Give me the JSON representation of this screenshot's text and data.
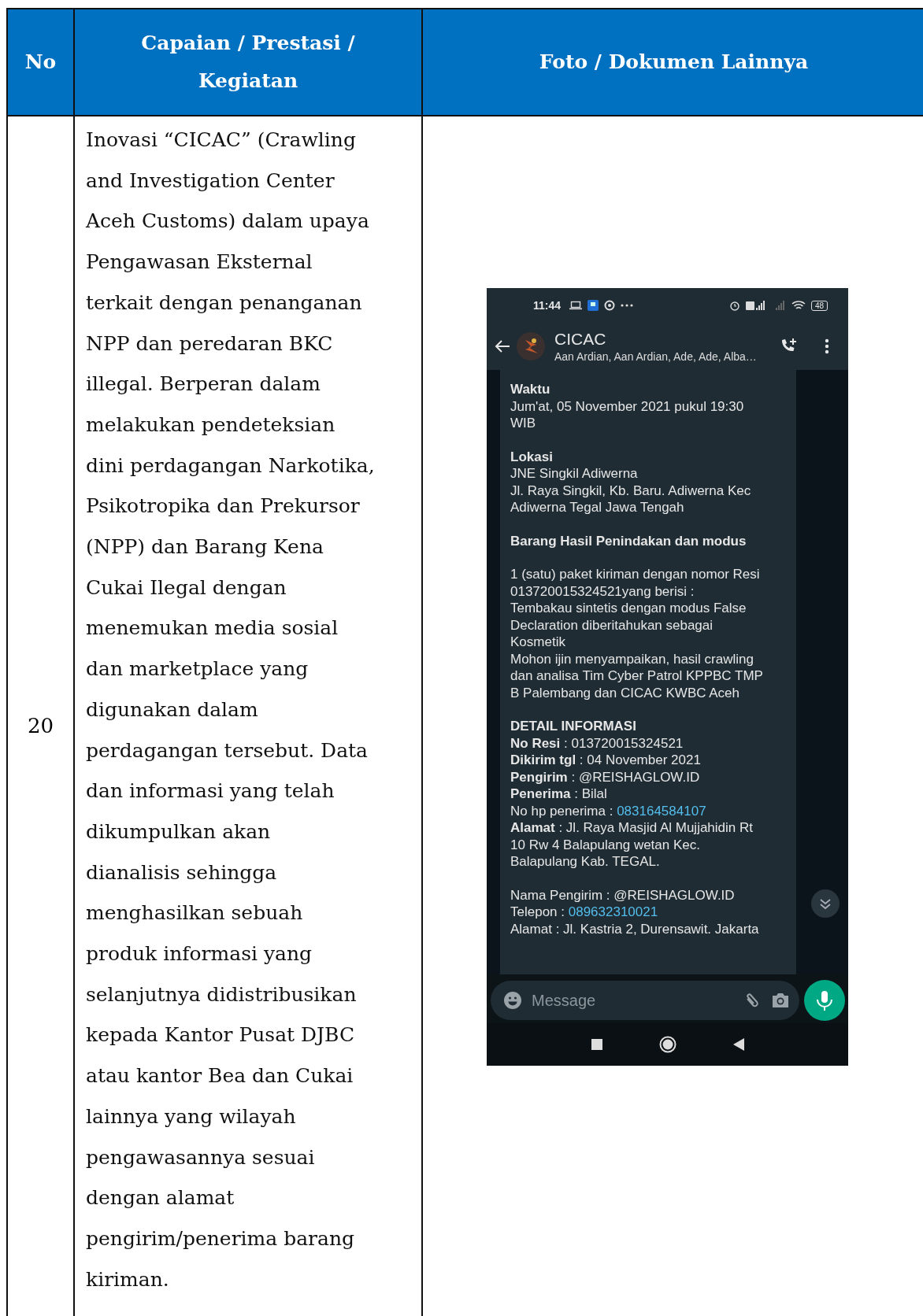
{
  "table": {
    "columns": [
      "No",
      "Capaian / Prestasi / Kegiatan",
      "Foto / Dokumen Lainnya"
    ],
    "rows": [
      {
        "no": "20",
        "description_lines": [
          "Inovasi “CICAC” (Crawling",
          "and Investigation Center",
          "Aceh Customs) dalam upaya",
          "Pengawasan Eksternal",
          "terkait dengan penanganan",
          "NPP dan peredaran BKC",
          "illegal. Berperan dalam",
          "melakukan pendeteksian",
          "dini perdagangan Narkotika,",
          "Psikotropika dan Prekursor",
          "(NPP) dan Barang Kena",
          "Cukai Ilegal dengan",
          "menemukan media sosial",
          "dan marketplace yang",
          "digunakan dalam",
          "perdagangan tersebut. Data",
          "dan informasi yang telah",
          "dikumpulkan akan",
          "dianalisis sehingga",
          "menghasilkan sebuah",
          "produk informasi yang",
          "selanjutnya didistribusikan",
          "kepada Kantor Pusat DJBC",
          "atau kantor Bea dan Cukai",
          "lainnya yang wilayah",
          "pengawasannya sesuai",
          "dengan alamat",
          "pengirim/penerima barang",
          "kiriman."
        ],
        "phone": {
          "status_time": "11:44",
          "battery": "48",
          "chat_title": "CICAC",
          "chat_members": "Aan Ardian, Aan Ardian, Ade, Ade, Alba…",
          "input_placeholder": "Message",
          "message_sections": [
            [
              {
                "kind": "heading",
                "text": "Waktu"
              },
              {
                "kind": "text",
                "text": "Jum'at, 05 November 2021 pukul 19:30"
              },
              {
                "kind": "text",
                "text": "WIB"
              }
            ],
            [
              {
                "kind": "heading",
                "text": "Lokasi"
              },
              {
                "kind": "text",
                "text": "JNE Singkil Adiwerna"
              },
              {
                "kind": "text",
                "text": "Jl. Raya Singkil, Kb. Baru. Adiwerna Kec"
              },
              {
                "kind": "text",
                "text": "Adiwerna Tegal Jawa Tengah"
              }
            ],
            [
              {
                "kind": "heading",
                "text": "Barang Hasil Penindakan dan modus"
              }
            ],
            [
              {
                "kind": "text",
                "text": "1 (satu) paket kiriman dengan nomor Resi"
              },
              {
                "kind": "text",
                "text": "013720015324521yang berisi :"
              },
              {
                "kind": "text",
                "text": "Tembakau sintetis dengan modus False"
              },
              {
                "kind": "text",
                "text": "Declaration diberitahukan sebagai"
              },
              {
                "kind": "text",
                "text": "Kosmetik"
              },
              {
                "kind": "text",
                "text": "Mohon ijin menyampaikan, hasil crawling"
              },
              {
                "kind": "text",
                "text": "dan analisa Tim Cyber Patrol KPPBC TMP"
              },
              {
                "kind": "text",
                "text": "B Palembang dan CICAC KWBC Aceh"
              }
            ],
            [
              {
                "kind": "heading",
                "text": "DETAIL INFORMASI"
              },
              {
                "kind": "text",
                "text": "**No Resi** :  013720015324521"
              },
              {
                "kind": "text",
                "text": "**Dikirim tgl** : 04 November 2021"
              },
              {
                "kind": "text",
                "text": "**Pengirim** : @REISHAGLOW.ID"
              },
              {
                "kind": "text",
                "text": "**Penerima** : Bilal"
              },
              {
                "kind": "link",
                "text": "No hp penerima : ",
                "link": "083164584107"
              },
              {
                "kind": "text",
                "text": "**Alamat** : Jl. Raya Masjid Al Mujjahidin Rt"
              },
              {
                "kind": "text",
                "text": "10 Rw 4 Balapulang wetan Kec."
              },
              {
                "kind": "text",
                "text": "Balapulang Kab. TEGAL."
              }
            ],
            [
              {
                "kind": "text",
                "text": "Nama Pengirim : @REISHAGLOW.ID"
              },
              {
                "kind": "link",
                "text": "Telepon : ",
                "link": "089632310021"
              },
              {
                "kind": "text",
                "text": "Alamat : Jl. Kastria 2, Durensawit. Jakarta"
              }
            ]
          ]
        }
      }
    ]
  }
}
